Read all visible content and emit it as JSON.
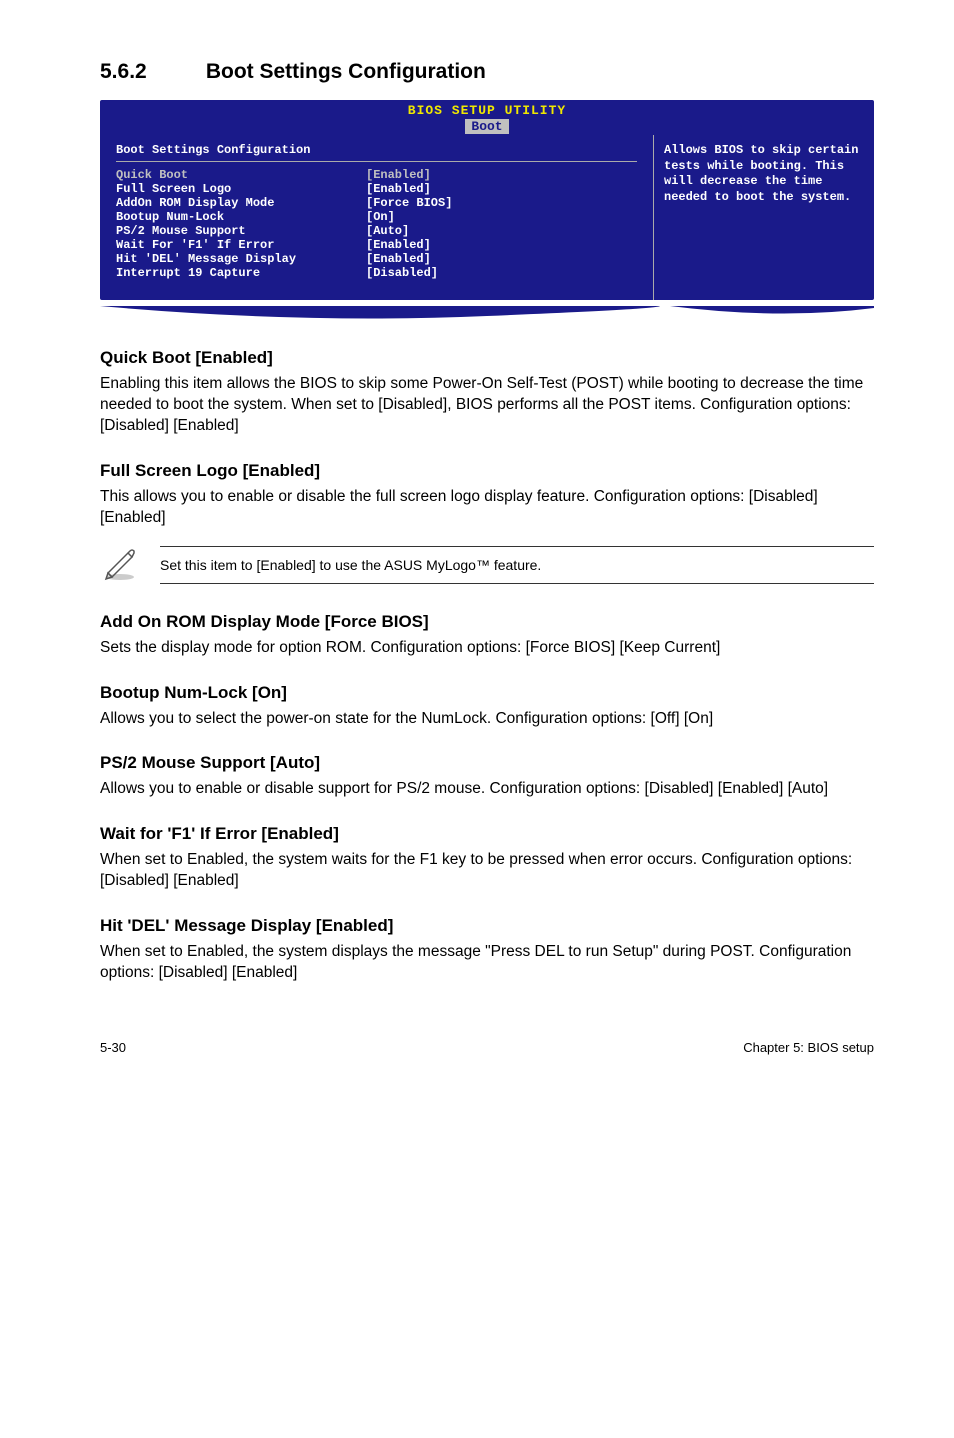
{
  "section": {
    "number": "5.6.2",
    "title": "Boot Settings Configuration"
  },
  "bios": {
    "title_line1": "BIOS SETUP UTILITY",
    "tab": "Boot",
    "panel_heading": "Boot Settings Configuration",
    "rows": [
      {
        "label": "Quick Boot",
        "value": "[Enabled]",
        "highlight": true
      },
      {
        "label": "Full Screen Logo",
        "value": "[Enabled]",
        "highlight": false
      },
      {
        "label": "AddOn ROM Display Mode",
        "value": "[Force BIOS]",
        "highlight": false
      },
      {
        "label": "Bootup Num-Lock",
        "value": "[On]",
        "highlight": false
      },
      {
        "label": "PS/2 Mouse Support",
        "value": "[Auto]",
        "highlight": false
      },
      {
        "label": "Wait For 'F1' If Error",
        "value": "[Enabled]",
        "highlight": false
      },
      {
        "label": "Hit 'DEL' Message Display",
        "value": "[Enabled]",
        "highlight": false
      },
      {
        "label": "Interrupt 19 Capture",
        "value": "[Disabled]",
        "highlight": false
      }
    ],
    "help_text": "Allows BIOS to skip certain tests while booting. This will decrease the time needed to boot the system."
  },
  "sections": {
    "quick_boot": {
      "heading": "Quick Boot [Enabled]",
      "body": "Enabling this item allows the BIOS to skip some Power-On Self-Test (POST) while booting to decrease the time needed to boot the system. When set to [Disabled], BIOS performs all the POST items. Configuration options: [Disabled] [Enabled]"
    },
    "full_screen": {
      "heading": "Full Screen Logo [Enabled]",
      "body": "This allows you to enable or disable the full screen logo display feature. Configuration options: [Disabled] [Enabled]"
    },
    "note": "Set this item to [Enabled] to use the ASUS MyLogo™ feature.",
    "addon": {
      "heading": "Add On ROM Display Mode [Force BIOS]",
      "body": "Sets the display mode for option ROM. Configuration options: [Force BIOS] [Keep Current]"
    },
    "numlock": {
      "heading": "Bootup Num-Lock [On]",
      "body": "Allows you to select the power-on state for the NumLock. Configuration options: [Off] [On]"
    },
    "ps2": {
      "heading": "PS/2 Mouse Support [Auto]",
      "body": "Allows you to enable or disable support for PS/2 mouse. Configuration options: [Disabled] [Enabled] [Auto]"
    },
    "wait_f1": {
      "heading": "Wait for 'F1' If Error [Enabled]",
      "body": "When set to Enabled, the system waits for the F1 key to be pressed when error occurs. Configuration options: [Disabled] [Enabled]"
    },
    "hit_del": {
      "heading": "Hit 'DEL' Message Display [Enabled]",
      "body": "When set to Enabled, the system displays the message \"Press DEL to run Setup\" during POST. Configuration options: [Disabled] [Enabled]"
    }
  },
  "footer": {
    "left": "5-30",
    "right": "Chapter 5: BIOS setup"
  }
}
